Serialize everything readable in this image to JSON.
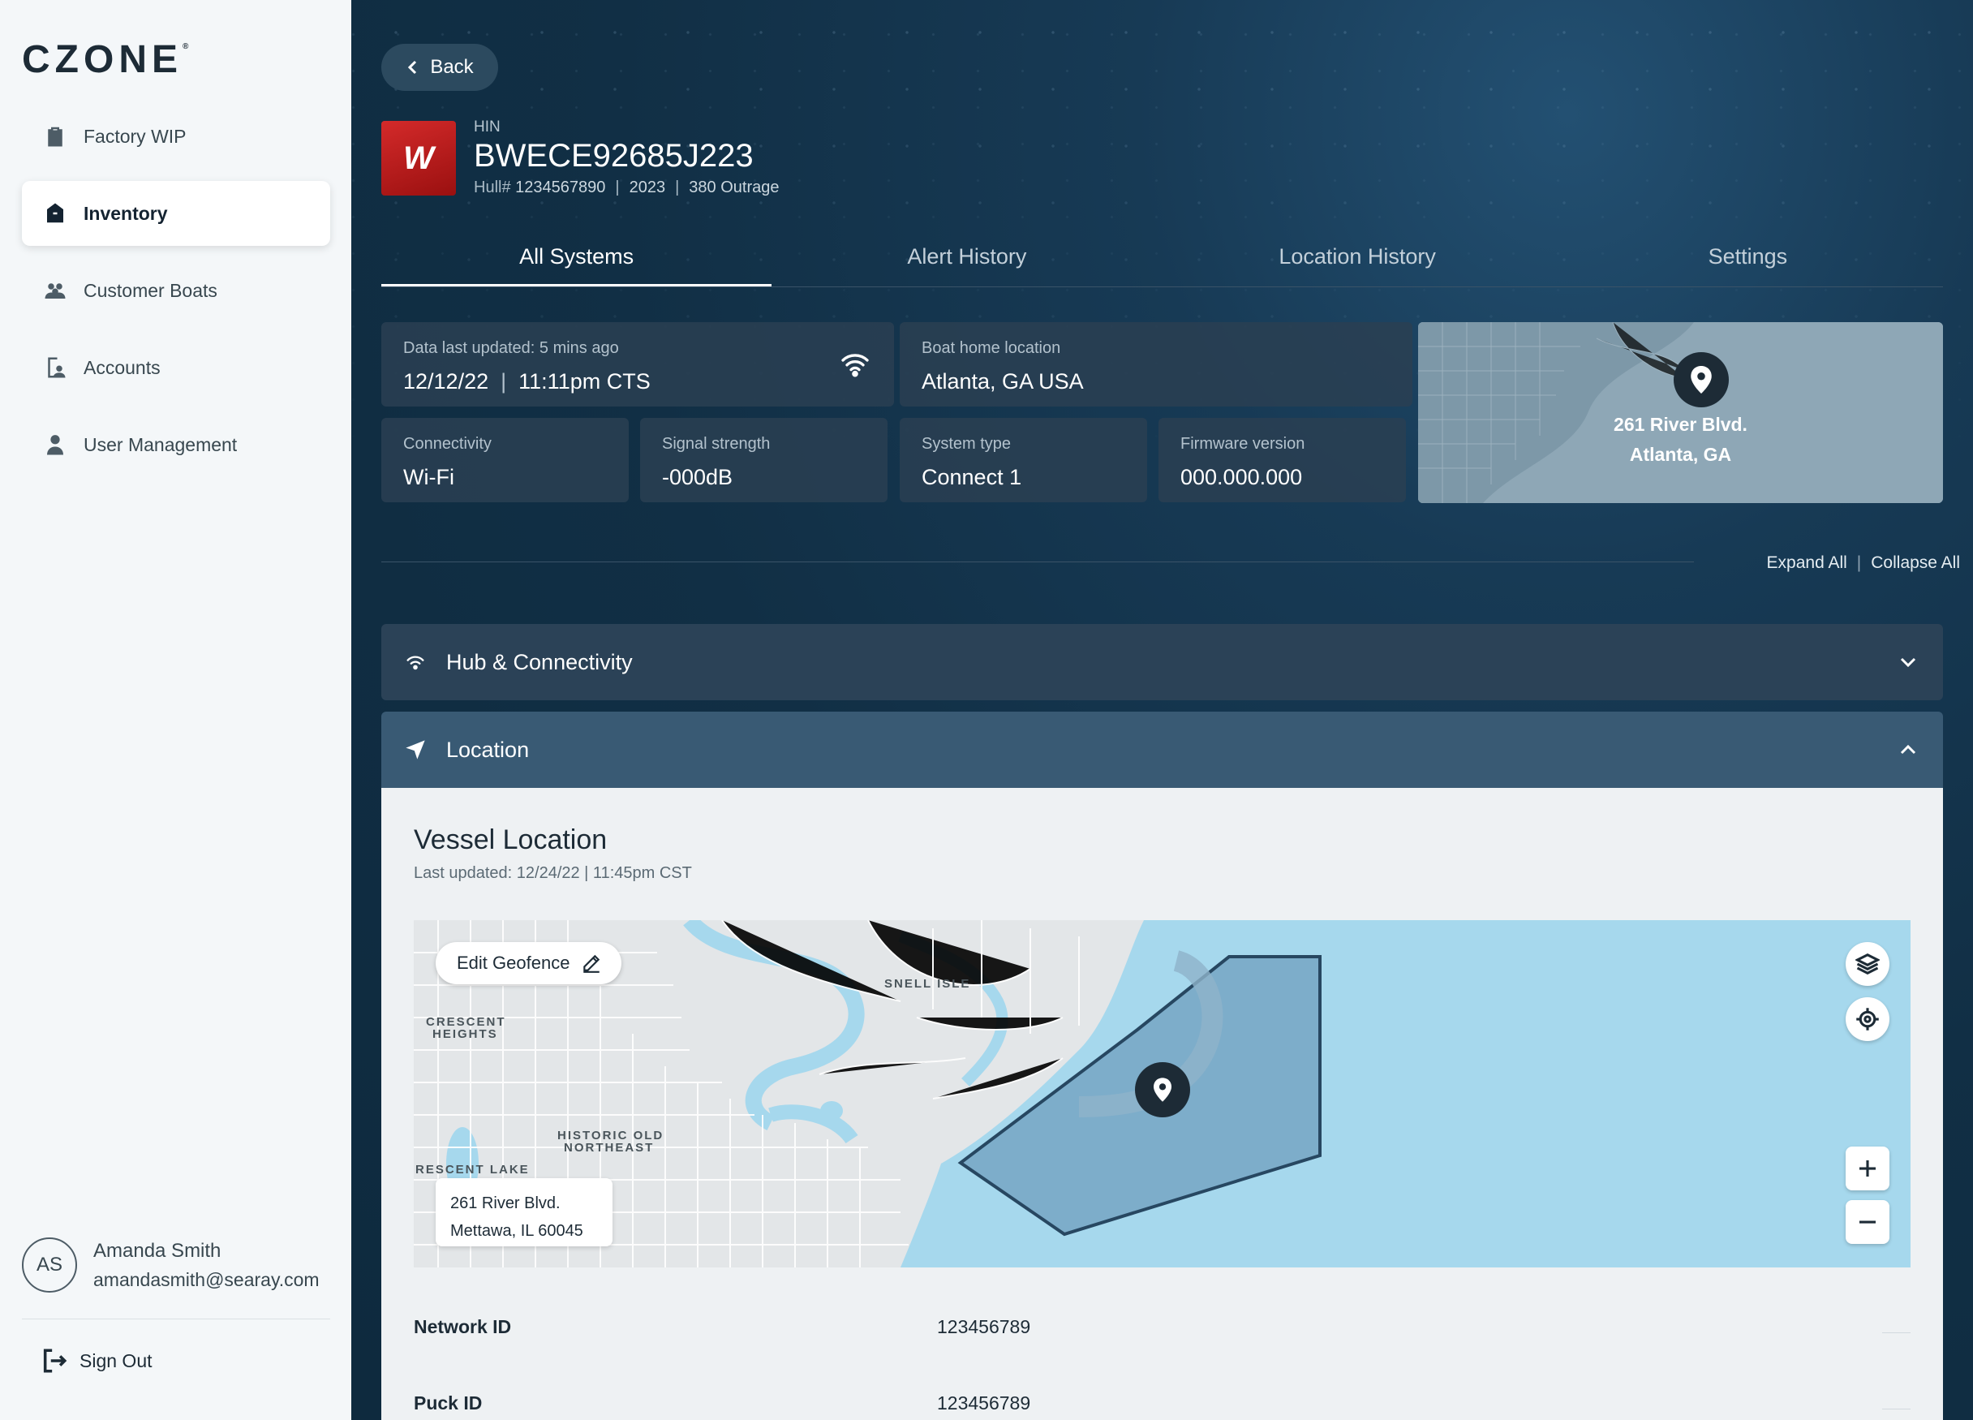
{
  "app": {
    "logo": "CZONE",
    "logo_mark": "®"
  },
  "sidebar": {
    "items": [
      {
        "label": "Factory WIP",
        "icon": "clipboard-icon",
        "active": false
      },
      {
        "label": "Inventory",
        "icon": "bag-icon",
        "active": true
      },
      {
        "label": "Customer Boats",
        "icon": "users-icon",
        "active": false
      },
      {
        "label": "Accounts",
        "icon": "account-icon",
        "active": false
      },
      {
        "label": "User Management",
        "icon": "person-icon",
        "active": false
      }
    ],
    "user": {
      "initials": "AS",
      "name": "Amanda Smith",
      "email": "amandasmith@searay.com"
    },
    "sign_out": "Sign Out"
  },
  "header": {
    "back": "Back",
    "brand_mark": "W",
    "hin_label": "HIN",
    "hin": "BWECE92685J223",
    "hull_label": "Hull#",
    "hull": "1234567890",
    "year": "2023",
    "model": "380 Outrage"
  },
  "tabs": [
    {
      "label": "All Systems",
      "active": true
    },
    {
      "label": "Alert History",
      "active": false
    },
    {
      "label": "Location History",
      "active": false
    },
    {
      "label": "Settings",
      "active": false
    }
  ],
  "summary": {
    "data_updated_label": "Data last updated: 5 mins ago",
    "data_updated_date": "12/12/22",
    "data_updated_time": "11:11pm CTS",
    "home_label": "Boat home location",
    "home_value": "Atlanta, GA USA",
    "connectivity_label": "Connectivity",
    "connectivity_value": "Wi-Fi",
    "signal_label": "Signal strength",
    "signal_value": "-000dB",
    "system_label": "System type",
    "system_value": "Connect 1",
    "firmware_label": "Firmware version",
    "firmware_value": "000.000.000",
    "map_address_line1": "261 River Blvd.",
    "map_address_line2": "Atlanta, GA"
  },
  "controls": {
    "expand_all": "Expand All",
    "collapse_all": "Collapse All"
  },
  "sections": {
    "hub": "Hub & Connectivity",
    "location": "Location"
  },
  "location": {
    "title": "Vessel Location",
    "updated": "Last updated: 12/24/22 | 11:45pm CST",
    "edit_geofence": "Edit Geofence",
    "map_labels": {
      "snell": "SNELL ISLE",
      "crescent_heights_1": "CRESCENT",
      "crescent_heights_2": "HEIGHTS",
      "historic_1": "HISTORIC OLD",
      "historic_2": "NORTHEAST",
      "crescent_lake": "RESCENT LAKE"
    },
    "address_line1": "261 River Blvd.",
    "address_line2": "Mettawa, IL 60045",
    "network_id_label": "Network ID",
    "network_id_value": "123456789",
    "puck_id_label": "Puck ID",
    "puck_id_value": "123456789"
  },
  "colors": {
    "sidebar_bg": "#f4f7f9",
    "main_bg": "#0f2c40",
    "card_bg": "#2a4052",
    "accordion_active": "#395a74",
    "water": "#a6d8ed",
    "geofence": "#6f9fbd"
  }
}
